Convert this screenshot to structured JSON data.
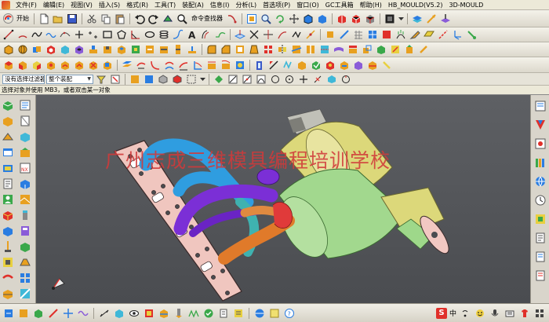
{
  "menubar": {
    "items": [
      "文件(F)",
      "编辑(E)",
      "视图(V)",
      "插入(S)",
      "格式(R)",
      "工具(T)",
      "装配(A)",
      "信息(I)",
      "分析(L)",
      "首选项(P)",
      "窗口(O)",
      "GC工具箱",
      "帮助(H)",
      "HB_MOULD(V5.2)",
      "3D-MOULD"
    ]
  },
  "toolbar_standard": {
    "start_label": "开始",
    "command_finder_label": "命令查找器"
  },
  "selection_bar": {
    "filter_value": "没有选择过滤器",
    "assembly_scope_value": "整个装配"
  },
  "cue_line": {
    "text": "选择对象并使用 MB3，或者双击某一对象"
  },
  "viewport": {
    "watermark": "广州志成三维模具编程培训学校",
    "background_top": "#5e6064",
    "background_bottom": "#4a4c50",
    "model_colors": {
      "flange_plate": "#f2c8c2",
      "runner_blue": "#2f9de0",
      "runner_purple": "#7b2fd6",
      "runner_orange": "#e07a2a",
      "runner_teal": "#3fb2b0",
      "runner_red": "#e03a3a",
      "canister_yellow": "#dcd87a",
      "canister_green": "#9ed88a",
      "bracket_grey": "#b8b8b0"
    }
  },
  "status_tray": {
    "ime_label": "S",
    "lang_label": "中"
  },
  "icons": {
    "colors": [
      "#2a7de1",
      "#e0302a",
      "#e8a020",
      "#3aa84a",
      "#8a5cd8",
      "#3fb8d8",
      "#666666"
    ]
  }
}
